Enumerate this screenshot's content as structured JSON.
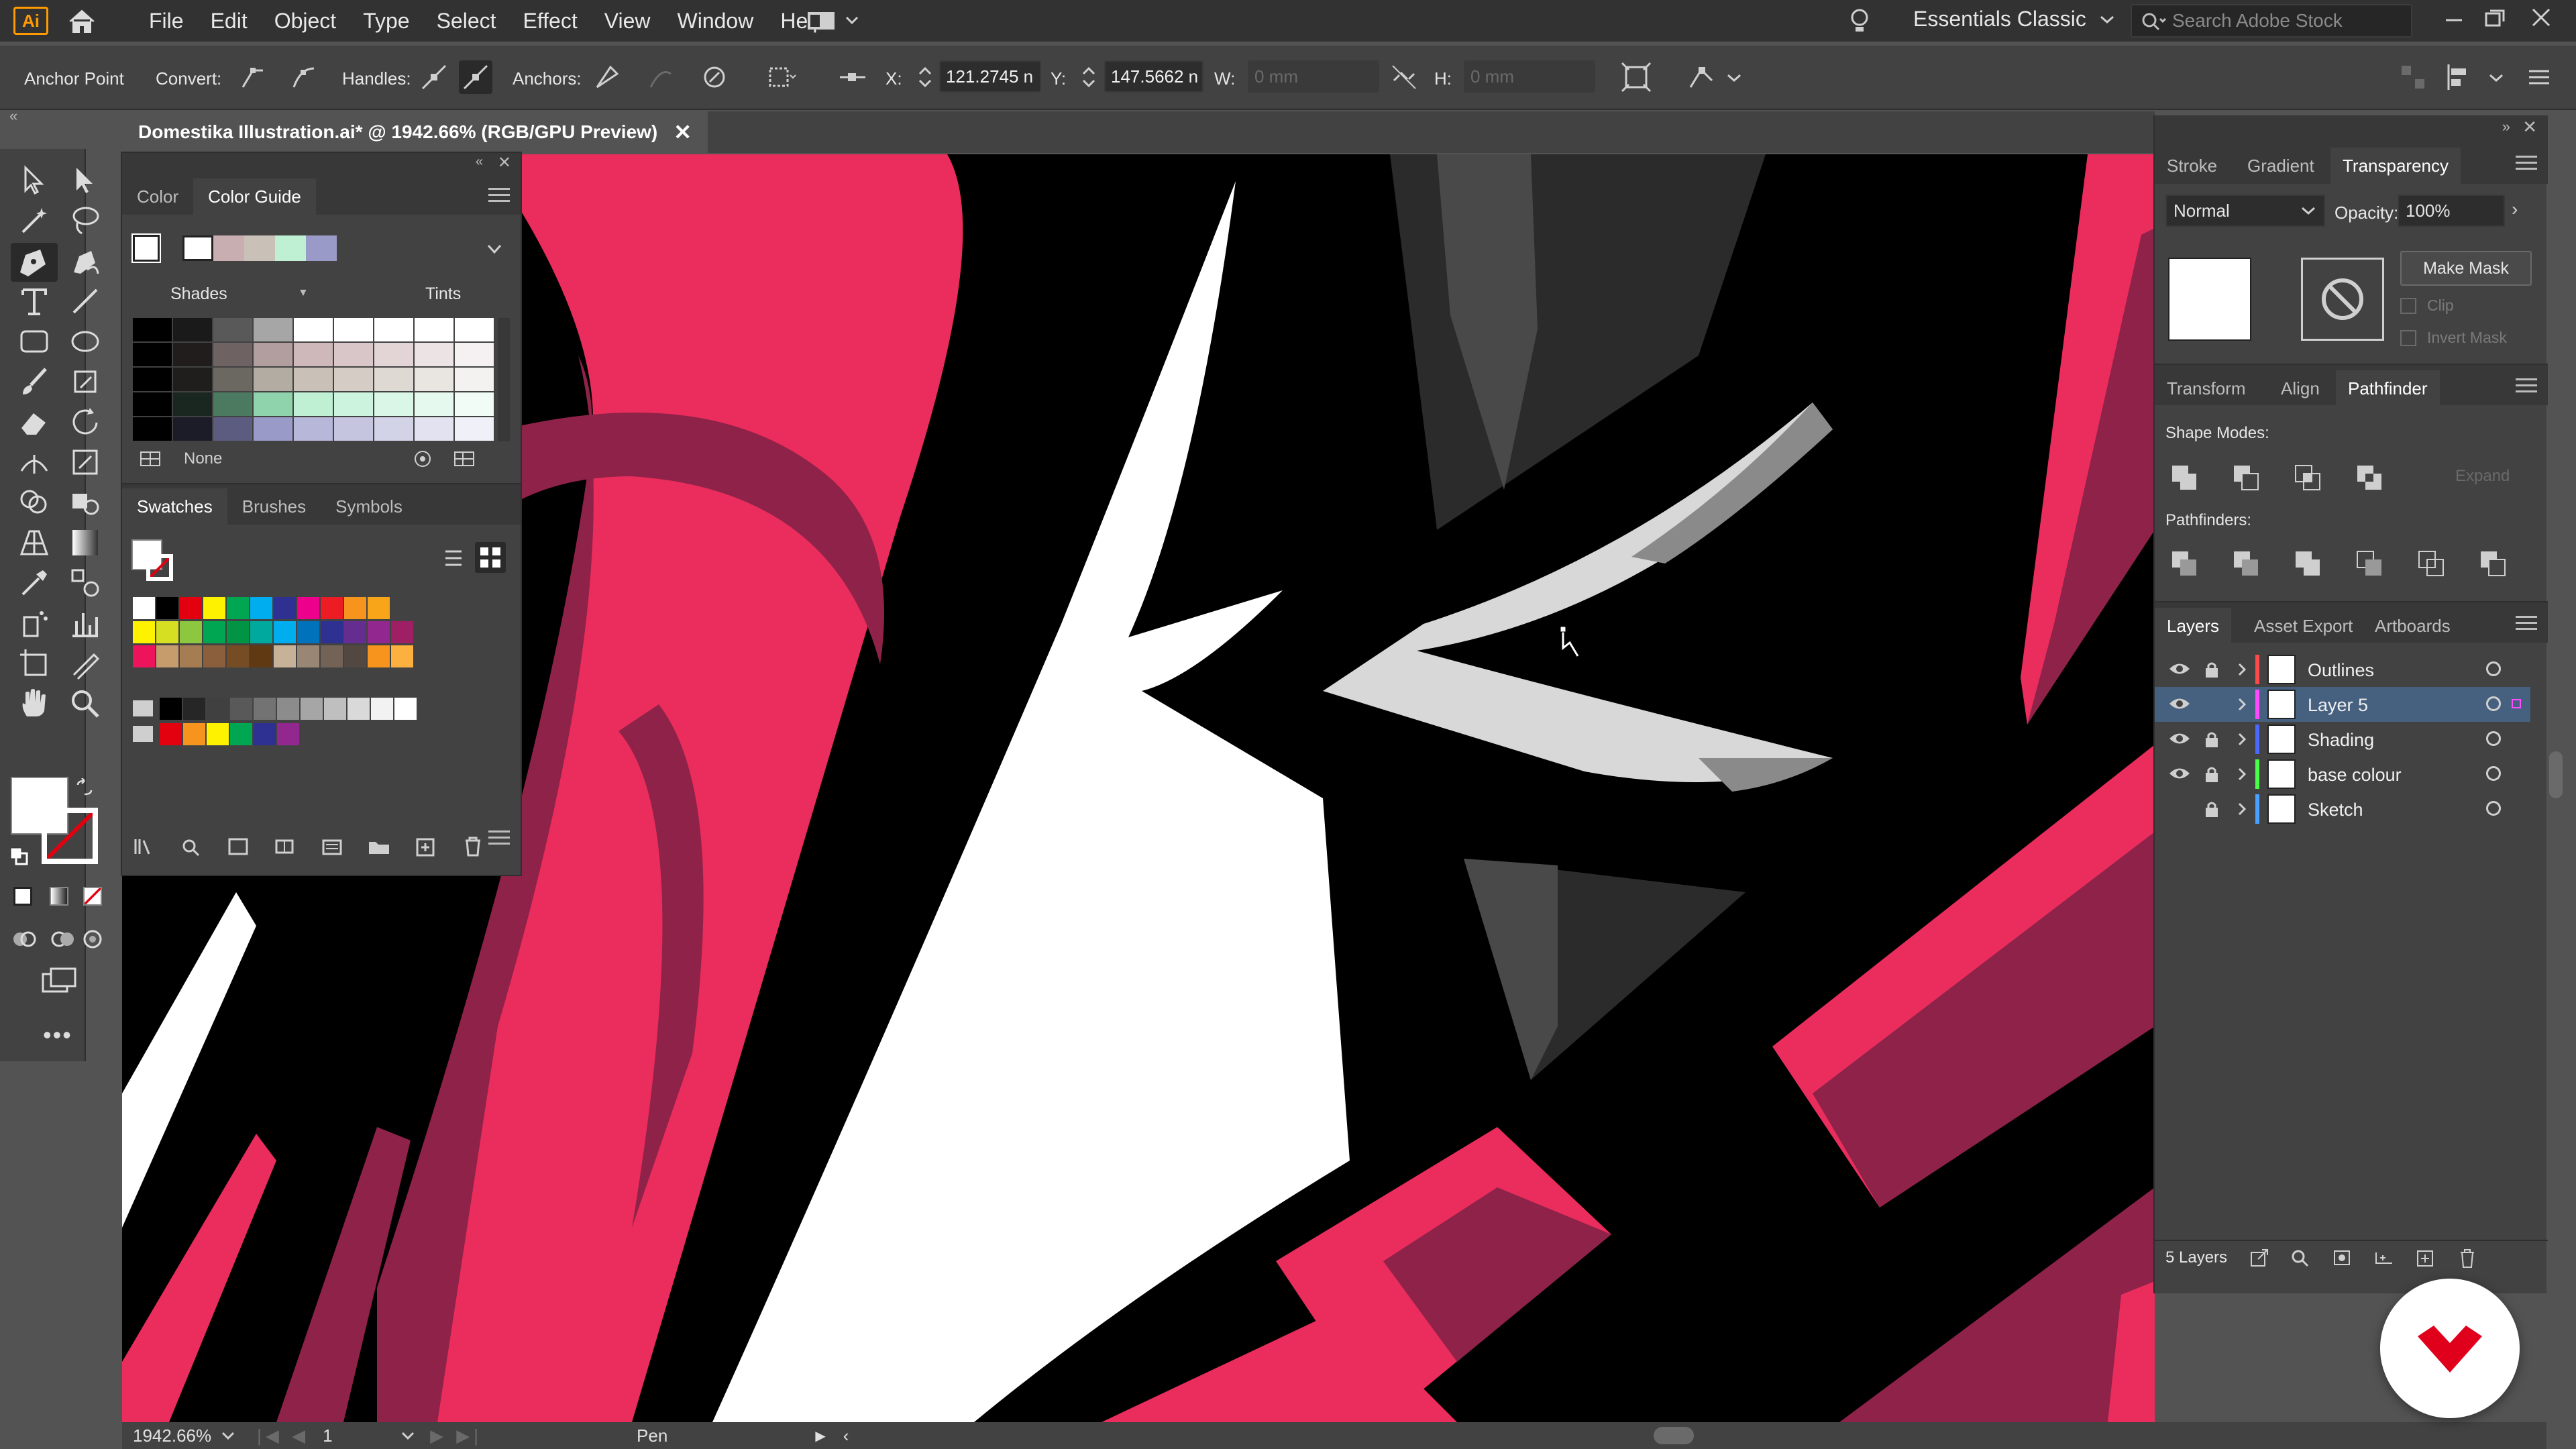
{
  "app": {
    "logo_text": "Ai",
    "menu": [
      "File",
      "Edit",
      "Object",
      "Type",
      "Select",
      "Effect",
      "View",
      "Window",
      "Help"
    ],
    "workspace": "Essentials Classic",
    "search_placeholder": "Search Adobe Stock"
  },
  "control_bar": {
    "tool_name": "Anchor Point",
    "convert_label": "Convert:",
    "handles_label": "Handles:",
    "anchors_label": "Anchors:",
    "x_label": "X:",
    "x_value": "121.2745 n",
    "y_label": "Y:",
    "y_value": "147.5662 n",
    "w_label": "W:",
    "w_value": "0 mm",
    "h_label": "H:",
    "h_value": "0 mm"
  },
  "document": {
    "tab_title": "Domestika Illustration.ai* @ 1942.66% (RGB/GPU Preview)",
    "close": "✕"
  },
  "color_panel": {
    "tabs": [
      "Color",
      "Color Guide"
    ],
    "active_tab": "Color Guide",
    "shades_label": "Shades",
    "tints_label": "Tints",
    "none_label": "None",
    "harmony": [
      "#ffffff",
      "#c8aeb0",
      "#c9c0b8",
      "#bff0d4",
      "#9a9ac8"
    ],
    "guide_rows": [
      [
        "#000000",
        "#1a1a1a",
        "#595959",
        "#a6a6a6",
        "#ffffff",
        "#ffffff",
        "#ffffff",
        "#ffffff",
        "#ffffff"
      ],
      [
        "#000000",
        "#211d1d",
        "#6f6263",
        "#b29d9f",
        "#cfb8ba",
        "#d9c6c8",
        "#e3d5d6",
        "#ece3e4",
        "#f5f0f1"
      ],
      [
        "#000000",
        "#1f1e1c",
        "#6b6862",
        "#b3aca2",
        "#c9c0b8",
        "#d4ccc5",
        "#dfd9d3",
        "#e9e5e1",
        "#f4f2f0"
      ],
      [
        "#000000",
        "#1a2620",
        "#4b7a61",
        "#8fd3ad",
        "#bff0d4",
        "#ccf3dd",
        "#d9f6e6",
        "#e5f9ee",
        "#f2fcf7"
      ],
      [
        "#000000",
        "#1c1c28",
        "#5c5c80",
        "#9a9ac8",
        "#b7b7d9",
        "#c5c5e0",
        "#d3d3e8",
        "#e2e2f0",
        "#f0f0f8"
      ]
    ]
  },
  "swatches_panel": {
    "tabs": [
      "Swatches",
      "Brushes",
      "Symbols"
    ],
    "active_tab": "Swatches",
    "row1": [
      "#ffffff",
      "#000000",
      "#e3000f",
      "#fff200",
      "#00a651",
      "#00aeef",
      "#2e3192",
      "#ec008c",
      "#ed1c24",
      "#f7941d",
      "#f9a51a"
    ],
    "row2": [
      "#fff200",
      "#d7df23",
      "#8dc63f",
      "#00a651",
      "#009444",
      "#00a99d",
      "#00aeef",
      "#0072bc",
      "#2e3192",
      "#662d91",
      "#92278f",
      "#9e1f63"
    ],
    "row3": [
      "#ed145b",
      "#c69c6d",
      "#a67c52",
      "#8b5e3c",
      "#754c24",
      "#603913",
      "#c7b299",
      "#998675",
      "#736357",
      "#534741",
      "#f7941d",
      "#fbb040"
    ],
    "row4": [
      "#000000",
      "#262626",
      "#404040",
      "#595959",
      "#737373",
      "#8c8c8c",
      "#a6a6a6",
      "#bfbfbf",
      "#d9d9d9",
      "#f2f2f2",
      "#ffffff"
    ],
    "row5": [
      "#e3000f",
      "#f7941d",
      "#fff200",
      "#00a651",
      "#2e3192",
      "#92278f"
    ]
  },
  "transparency_panel": {
    "tabs": [
      "Stroke",
      "Gradient",
      "Transparency"
    ],
    "active_tab": "Transparency",
    "blend_mode": "Normal",
    "opacity_label": "Opacity:",
    "opacity_value": "100%",
    "make_mask": "Make Mask",
    "clip": "Clip",
    "invert_mask": "Invert Mask"
  },
  "pathfinder_panel": {
    "tabs": [
      "Transform",
      "Align",
      "Pathfinder"
    ],
    "active_tab": "Pathfinder",
    "shape_modes_label": "Shape Modes:",
    "pathfinders_label": "Pathfinders:",
    "expand": "Expand"
  },
  "layers_panel": {
    "tabs": [
      "Layers",
      "Asset Export",
      "Artboards"
    ],
    "active_tab": "Layers",
    "layers": [
      {
        "name": "Outlines",
        "color": "#ff4a4a",
        "visible": true,
        "locked": true
      },
      {
        "name": "Layer 5",
        "color": "#ff4aff",
        "visible": true,
        "locked": false
      },
      {
        "name": "Shading",
        "color": "#4a6aff",
        "visible": true,
        "locked": true
      },
      {
        "name": "base colour",
        "color": "#4aff4a",
        "visible": true,
        "locked": true
      },
      {
        "name": "Sketch",
        "color": "#4aa0ff",
        "visible": false,
        "locked": true
      }
    ],
    "count_label": "5 Layers"
  },
  "status_bar": {
    "zoom": "1942.66%",
    "artboard": "1",
    "tool": "Pen"
  },
  "colors": {
    "pink": "#ea2d5c",
    "maroon": "#8e2249",
    "dark_grey": "#2b2b2b",
    "mid_grey": "#494949",
    "light_grey": "#d8d8d8"
  }
}
